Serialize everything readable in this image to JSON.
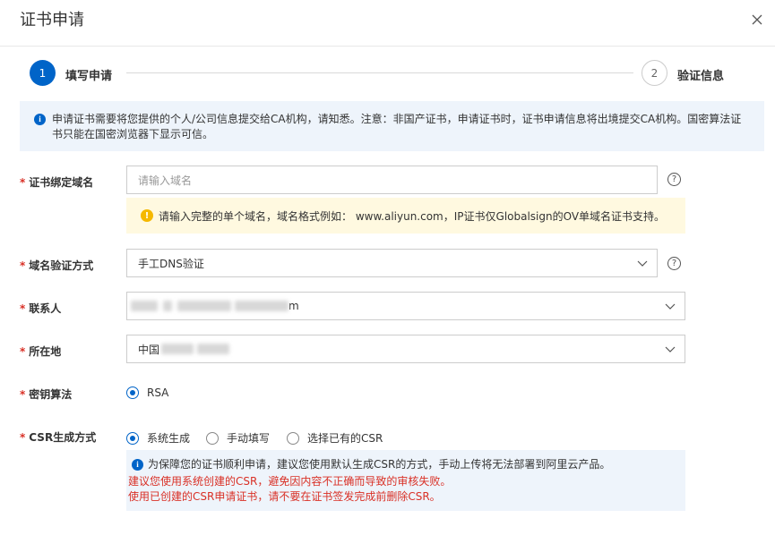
{
  "dialog": {
    "title": "证书申请",
    "close_icon": "close-icon"
  },
  "steps": [
    {
      "number": "1",
      "label": "填写申请",
      "state": "active"
    },
    {
      "number": "2",
      "label": "验证信息",
      "state": "inactive"
    }
  ],
  "notice": {
    "text": "申请证书需要将您提供的个人/公司信息提交给CA机构，请知悉。注意：非国产证书，申请证书时，证书申请信息将出境提交CA机构。国密算法证书只能在国密浏览器下显示可信。"
  },
  "form": {
    "domain": {
      "label": "证书绑定域名",
      "placeholder": "请输入域名",
      "value": "",
      "help_icon": "question-circle-icon",
      "warning": "请输入完整的单个域名，域名格式例如： www.aliyun.com，IP证书仅Globalsign的OV单域名证书支持。"
    },
    "verify_method": {
      "label": "域名验证方式",
      "value": "手工DNS验证"
    },
    "contact": {
      "label": "联系人",
      "visible_suffix": "m"
    },
    "location": {
      "label": "所在地",
      "visible_prefix": "中国"
    },
    "key_algorithm": {
      "label": "密钥算法",
      "options": [
        {
          "label": "RSA",
          "checked": true
        }
      ]
    },
    "csr_method": {
      "label": "CSR生成方式",
      "options": [
        {
          "label": "系统生成",
          "checked": true
        },
        {
          "label": "手动填写",
          "checked": false
        },
        {
          "label": "选择已有的CSR",
          "checked": false
        }
      ],
      "tip": "为保障您的证书顺利申请，建议您使用默认生成CSR的方式，手动上传将无法部署到阿里云产品。",
      "red_tip_1": "建议您使用系统创建的CSR，避免因内容不正确而导致的审核失败。",
      "red_tip_2": "使用已创建的CSR申请证书，请不要在证书签发完成前删除CSR。"
    }
  },
  "colors": {
    "primary": "#0064c8",
    "required": "#d93026",
    "warning_bg": "#fff9e0",
    "info_bg": "#eef4fb"
  }
}
